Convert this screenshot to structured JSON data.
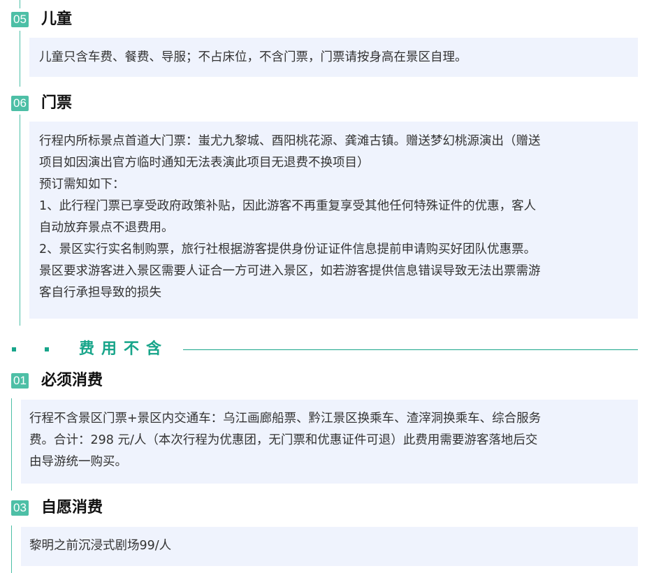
{
  "sections": {
    "children": {
      "number": "05",
      "title": "儿童",
      "lines": [
        "儿童只含车费、餐费、导服；不占床位，不含门票，门票请按身高在景区自理。"
      ]
    },
    "tickets": {
      "number": "06",
      "title": "门票",
      "lines": [
        "行程内所标景点首道大门票：蚩尤九黎城、酉阳桃花源、龚滩古镇。赠送梦幻桃源演出（赠送",
        "项目如因演出官方临时通知无法表演此项目无退费不换项目）",
        "预订需知如下：",
        "1、此行程门票已享受政府政策补贴，因此游客不再重复享受其他任何特殊证件的优惠，客人",
        "自动放弃景点不退费用。",
        "2、景区实行实名制购票，旅行社根据游客提供身份证证件信息提前申请购买好团队优惠票。",
        "景区要求游客进入景区需要人证合一方可进入景区，如若游客提供信息错误导致无法出票需游",
        "客自行承担导致的损失"
      ]
    }
  },
  "fees_excluded": {
    "heading": "费用不含",
    "required": {
      "number": "01",
      "title": "必须消费",
      "lines": [
        "行程不含景区门票+景区内交通车：乌江画廊船票、黔江景区换乘车、渣滓洞换乘车、综合服务",
        "费。合计：298 元/人（本次行程为优惠团，无门票和优惠证件可退）此费用需要游客落地后交",
        "由导游统一购买。"
      ]
    },
    "optional": {
      "number": "03",
      "title": "自愿消费",
      "lines": [
        "黎明之前沉浸式剧场99/人"
      ]
    }
  },
  "colors": {
    "accent": "#18a58a",
    "badge": "#4dbfa6",
    "box_bg": "#eff3fd",
    "title_text": "#111111",
    "body_text": "#333333"
  }
}
